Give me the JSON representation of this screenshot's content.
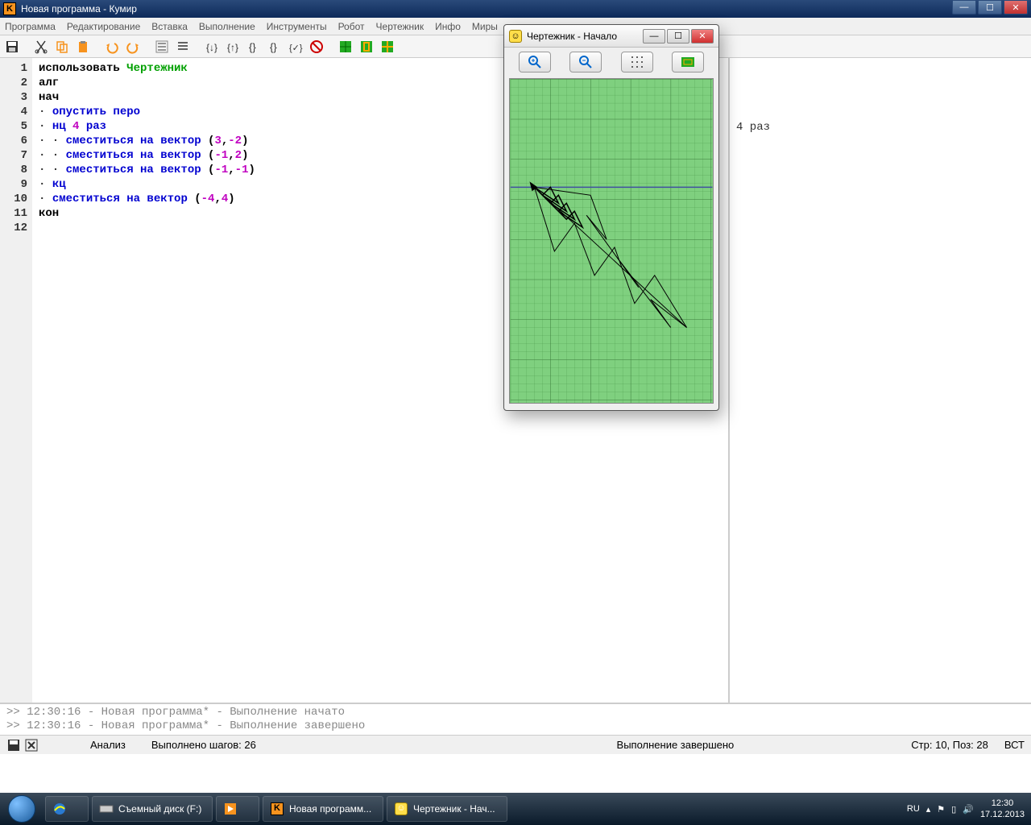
{
  "window": {
    "title": "Новая программа - Кумир"
  },
  "menu": {
    "items": [
      "Программа",
      "Редактирование",
      "Вставка",
      "Выполнение",
      "Инструменты",
      "Робот",
      "Чертежник",
      "Инфо",
      "Миры"
    ]
  },
  "code": {
    "lines": [
      {
        "n": 1,
        "parts": [
          {
            "t": "использовать ",
            "c": "plain"
          },
          {
            "t": "Чертежник",
            "c": "mod"
          }
        ]
      },
      {
        "n": 2,
        "parts": [
          {
            "t": "алг",
            "c": "plain"
          }
        ]
      },
      {
        "n": 3,
        "parts": [
          {
            "t": "нач",
            "c": "plain"
          }
        ]
      },
      {
        "n": 4,
        "parts": [
          {
            "t": "· ",
            "c": "bullet"
          },
          {
            "t": "опустить перо",
            "c": "kw"
          }
        ]
      },
      {
        "n": 5,
        "parts": [
          {
            "t": "· ",
            "c": "bullet"
          },
          {
            "t": "нц ",
            "c": "kw"
          },
          {
            "t": "4",
            "c": "num"
          },
          {
            "t": " раз",
            "c": "kw"
          }
        ]
      },
      {
        "n": 6,
        "parts": [
          {
            "t": "· · ",
            "c": "bullet"
          },
          {
            "t": "сместиться на вектор ",
            "c": "kw"
          },
          {
            "t": "(",
            "c": "plain"
          },
          {
            "t": "3",
            "c": "num"
          },
          {
            "t": ",",
            "c": "plain"
          },
          {
            "t": "-2",
            "c": "num"
          },
          {
            "t": ")",
            "c": "plain"
          }
        ]
      },
      {
        "n": 7,
        "parts": [
          {
            "t": "· · ",
            "c": "bullet"
          },
          {
            "t": "сместиться на вектор ",
            "c": "kw"
          },
          {
            "t": "(",
            "c": "plain"
          },
          {
            "t": "-1",
            "c": "num"
          },
          {
            "t": ",",
            "c": "plain"
          },
          {
            "t": "2",
            "c": "num"
          },
          {
            "t": ")",
            "c": "plain"
          }
        ]
      },
      {
        "n": 8,
        "parts": [
          {
            "t": "· · ",
            "c": "bullet"
          },
          {
            "t": "сместиться на вектор ",
            "c": "kw"
          },
          {
            "t": "(",
            "c": "plain"
          },
          {
            "t": "-1",
            "c": "num"
          },
          {
            "t": ",",
            "c": "plain"
          },
          {
            "t": "-1",
            "c": "num"
          },
          {
            "t": ")",
            "c": "plain"
          }
        ]
      },
      {
        "n": 9,
        "parts": [
          {
            "t": "· ",
            "c": "bullet"
          },
          {
            "t": "кц",
            "c": "kw"
          }
        ]
      },
      {
        "n": 10,
        "parts": [
          {
            "t": "· ",
            "c": "bullet"
          },
          {
            "t": "сместиться на вектор ",
            "c": "kw"
          },
          {
            "t": "(",
            "c": "plain"
          },
          {
            "t": "-4",
            "c": "num"
          },
          {
            "t": ",",
            "c": "plain"
          },
          {
            "t": "4",
            "c": "num"
          },
          {
            "t": ")",
            "c": "plain"
          }
        ]
      },
      {
        "n": 11,
        "parts": [
          {
            "t": "кон",
            "c": "plain"
          }
        ]
      },
      {
        "n": 12,
        "parts": []
      }
    ]
  },
  "side": {
    "text": "4 раз"
  },
  "console": {
    "line1": ">> 12:30:16 - Новая программа* - Выполнение начато",
    "line2": ">> 12:30:16 - Новая программа* - Выполнение завершено"
  },
  "status": {
    "analysis": "Анализ",
    "steps": "Выполнено шагов: 26",
    "done": "Выполнение завершено",
    "pos": "Стр: 10, Поз: 28",
    "ins": "ВСТ"
  },
  "drafter": {
    "title": "Чертежник - Начало"
  },
  "taskbar": {
    "items": [
      {
        "label": "Съемный диск (F:)"
      },
      {
        "label": ""
      },
      {
        "label": "Новая программ..."
      },
      {
        "label": "Чертежник - Нач..."
      }
    ],
    "lang": "RU",
    "time": "12:30",
    "date": "17.12.2013"
  }
}
